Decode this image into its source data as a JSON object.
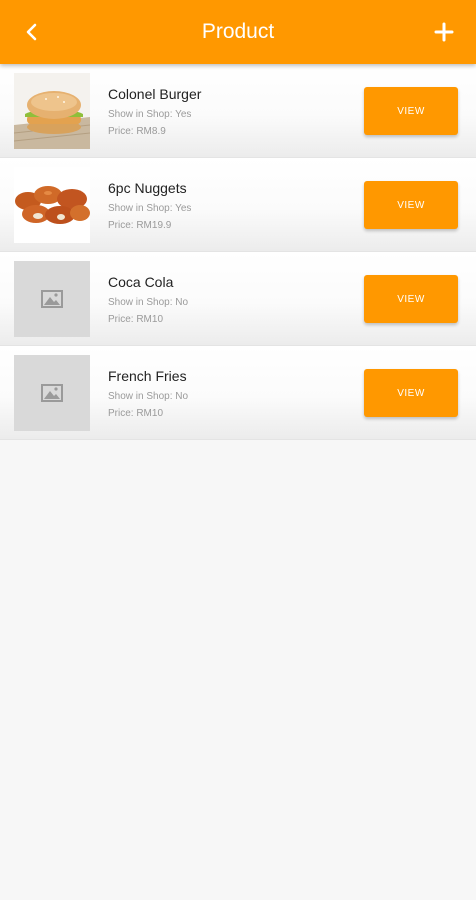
{
  "header": {
    "title": "Product",
    "back_icon": "chevron-left-icon",
    "add_icon": "plus-icon"
  },
  "colors": {
    "primary": "#ff9800",
    "placeholder_bg": "#d9d9d9"
  },
  "products": [
    {
      "name": "Colonel Burger",
      "show_in_shop": "Show in Shop: Yes",
      "price": "Price: RM8.9",
      "view_label": "VIEW",
      "thumbnail": "burger-photo"
    },
    {
      "name": "6pc Nuggets",
      "show_in_shop": "Show in Shop: Yes",
      "price": "Price: RM19.9",
      "view_label": "VIEW",
      "thumbnail": "nuggets-photo"
    },
    {
      "name": "Coca Cola",
      "show_in_shop": "Show in Shop: No",
      "price": "Price: RM10",
      "view_label": "VIEW",
      "thumbnail": "image-placeholder-icon"
    },
    {
      "name": "French Fries",
      "show_in_shop": "Show in Shop: No",
      "price": "Price: RM10",
      "view_label": "VIEW",
      "thumbnail": "image-placeholder-icon"
    }
  ]
}
